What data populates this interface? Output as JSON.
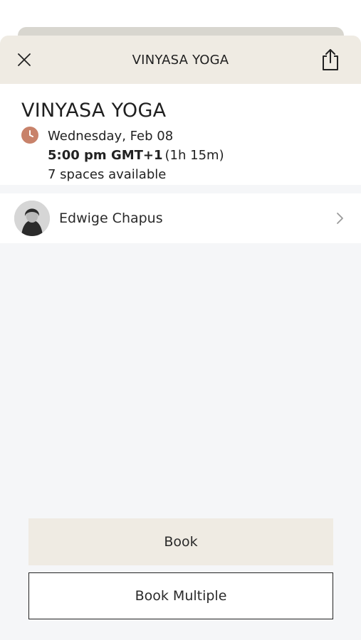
{
  "header": {
    "title": "VINYASA YOGA",
    "close_icon": "close-icon",
    "share_icon": "share-icon"
  },
  "class_info": {
    "title": "VINYASA YOGA",
    "date": "Wednesday, Feb 08",
    "time": "5:00 pm GMT+1",
    "duration": "(1h 15m)",
    "availability": "7 spaces available",
    "clock_icon": "clock-icon",
    "accent_color": "#c8826a"
  },
  "instructor": {
    "name": "Edwige Chapus",
    "avatar": "avatar",
    "chevron_icon": "chevron-right-icon"
  },
  "actions": {
    "book_label": "Book",
    "book_multiple_label": "Book Multiple"
  },
  "colors": {
    "header_bg": "#efebe3",
    "primary_button_bg": "#efebe3",
    "page_bg": "#f5f6f8"
  }
}
